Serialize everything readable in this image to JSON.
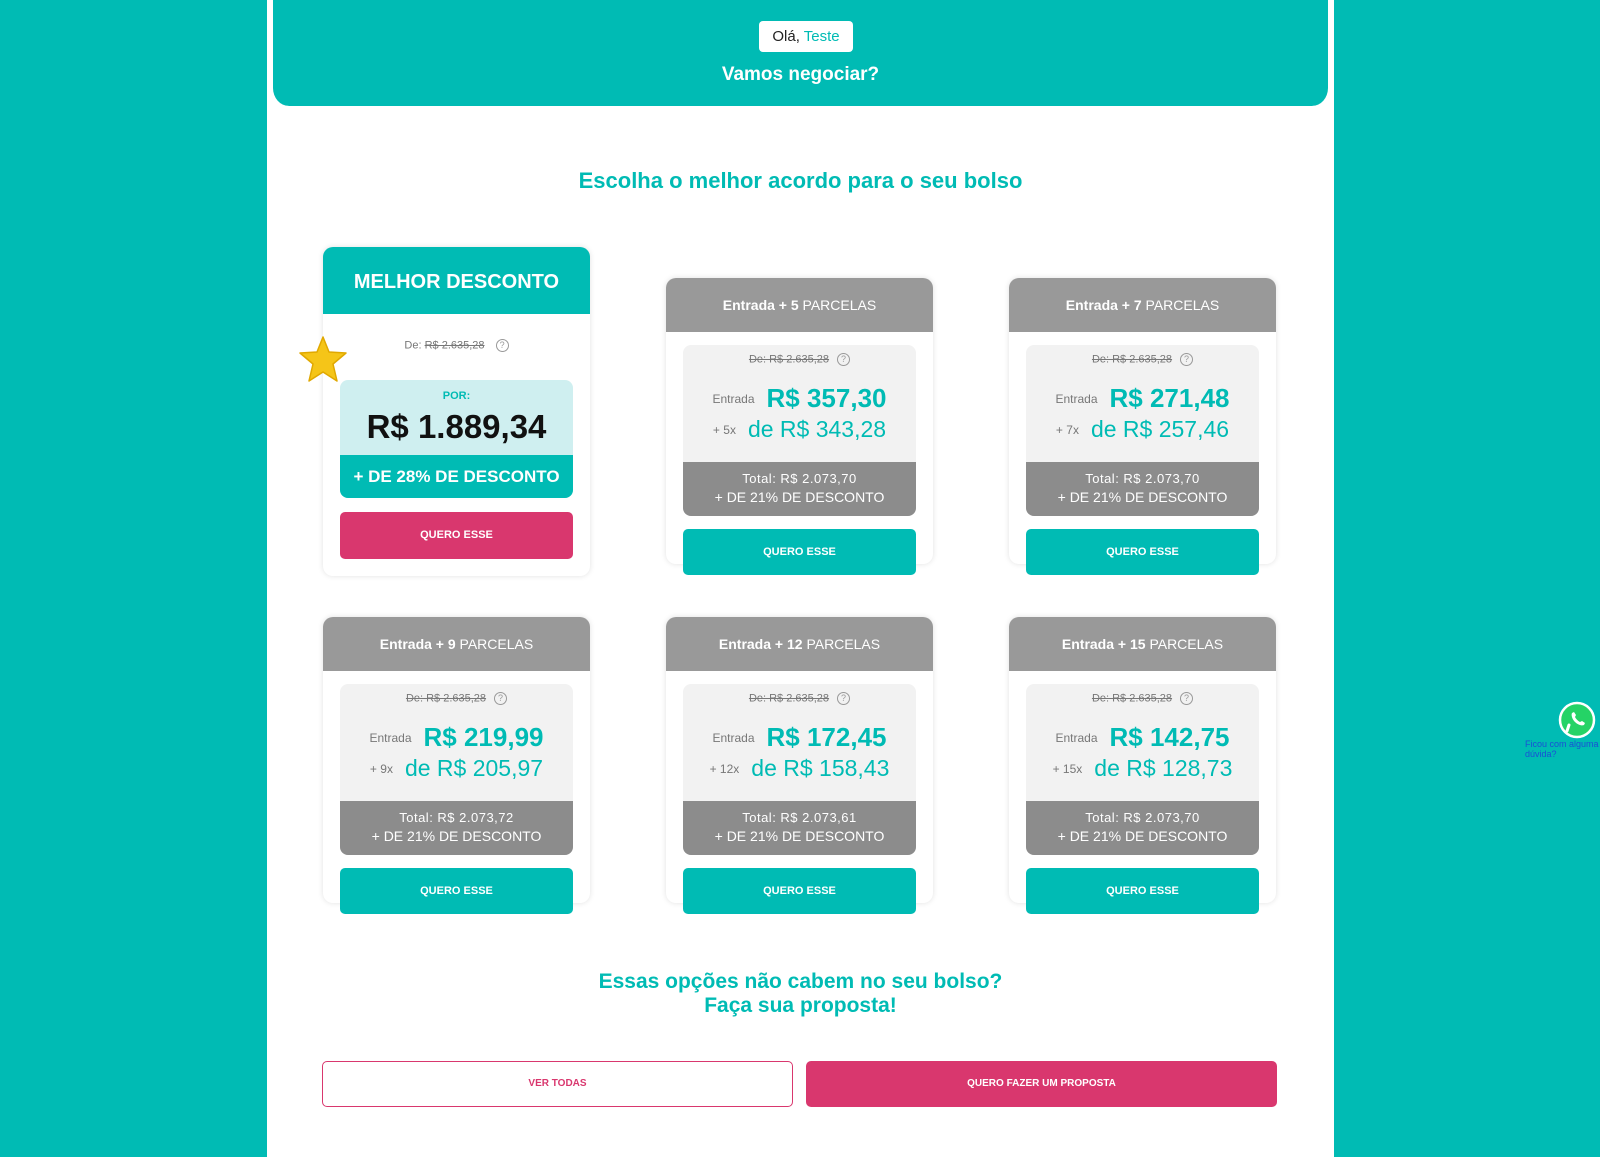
{
  "header": {
    "greeting": "Olá,",
    "user_name": "Teste",
    "subtitle": "Vamos negociar?"
  },
  "section_title": "Escolha o melhor acordo para o seu bolso",
  "best_offer": {
    "title": "MELHOR DESCONTO",
    "de_label": "De:",
    "de_value": "R$ 2.635,28",
    "por_label": "POR:",
    "por_value": "R$ 1.889,34",
    "discount": "+ DE 28% DE DESCONTO",
    "button": "QUERO ESSE"
  },
  "offers": [
    {
      "head_bold": "Entrada + 5",
      "head_rest": "PARCELAS",
      "de": "De: R$ 2.635,28",
      "entrada_label": "Entrada",
      "entrada": "R$ 357,30",
      "parc_label": "+ 5x",
      "parc": "de R$ 343,28",
      "total": "Total: R$ 2.073,70",
      "discount": "+ DE 21% DE DESCONTO",
      "button": "QUERO ESSE"
    },
    {
      "head_bold": "Entrada + 7",
      "head_rest": "PARCELAS",
      "de": "De: R$ 2.635,28",
      "entrada_label": "Entrada",
      "entrada": "R$ 271,48",
      "parc_label": "+ 7x",
      "parc": "de R$ 257,46",
      "total": "Total: R$ 2.073,70",
      "discount": "+ DE 21% DE DESCONTO",
      "button": "QUERO ESSE"
    },
    {
      "head_bold": "Entrada + 9",
      "head_rest": "PARCELAS",
      "de": "De: R$ 2.635,28",
      "entrada_label": "Entrada",
      "entrada": "R$ 219,99",
      "parc_label": "+ 9x",
      "parc": "de R$ 205,97",
      "total": "Total: R$ 2.073,72",
      "discount": "+ DE 21% DE DESCONTO",
      "button": "QUERO ESSE"
    },
    {
      "head_bold": "Entrada + 12",
      "head_rest": "PARCELAS",
      "de": "De: R$ 2.635,28",
      "entrada_label": "Entrada",
      "entrada": "R$ 172,45",
      "parc_label": "+ 12x",
      "parc": "de R$ 158,43",
      "total": "Total: R$ 2.073,61",
      "discount": "+ DE 21% DE DESCONTO",
      "button": "QUERO ESSE"
    },
    {
      "head_bold": "Entrada + 15",
      "head_rest": "PARCELAS",
      "de": "De: R$ 2.635,28",
      "entrada_label": "Entrada",
      "entrada": "R$ 142,75",
      "parc_label": "+ 15x",
      "parc": "de R$ 128,73",
      "total": "Total: R$ 2.073,70",
      "discount": "+ DE 21% DE DESCONTO",
      "button": "QUERO ESSE"
    }
  ],
  "bottom": {
    "title_line1": "Essas opções não cabem no seu bolso?",
    "title_line2": "Faça sua proposta!",
    "see_all": "VER TODAS",
    "proposal": "QUERO FAZER UM PROPOSTA"
  },
  "whatsapp": {
    "text": "Ficou com alguma dúvida?",
    "icon": "whatsapp-icon"
  },
  "colors": {
    "teal": "#00bbb4",
    "pink": "#d9376e",
    "gray_head": "#999999",
    "gray_total": "#8c8c8c"
  }
}
